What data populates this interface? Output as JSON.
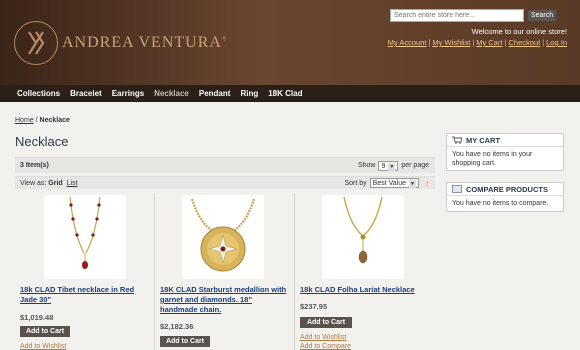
{
  "header": {
    "brand": "ANDREA VENTURA",
    "trademark": "®",
    "search_placeholder": "Search entire store here...",
    "search_button": "Search",
    "welcome": "Welcome to our online store!",
    "account_links": [
      "My Account",
      "My Wishlist",
      "My Cart",
      "Checkout",
      "Log In"
    ]
  },
  "nav": {
    "items": [
      "Collections",
      "Bracelet",
      "Earrings",
      "Necklace",
      "Pendant",
      "Ring",
      "18K Clad"
    ],
    "active": "Necklace"
  },
  "breadcrumb": {
    "home": "Home",
    "separator": "/",
    "current": "Necklace"
  },
  "page_title": "Necklace",
  "toolbar": {
    "item_count": "3 Item(s)",
    "show_label": "Show",
    "show_value": "9",
    "per_page": "per page",
    "view_as": "View as:",
    "view_grid": "Grid",
    "view_list": "List",
    "sort_by": "Sort by",
    "sort_value": "Best Value",
    "sort_direction_icon": "arrow-up-icon"
  },
  "products": [
    {
      "name": "18k CLAD Tibet necklace in Red Jade 30\"",
      "price": "$1,019.48",
      "add_to_cart": "Add to Cart",
      "link": "Add to Wishlist"
    },
    {
      "name": "18K CLAD Starburst medallion with garnet and diamonds. 18\" handmade chain.",
      "price": "$2,182.36",
      "add_to_cart": "Add to Cart"
    },
    {
      "name": "18k CLAD Folha Lariat Necklace",
      "price": "$237.95",
      "add_to_cart": "Add to Cart",
      "wishlist": "Add to Wishlist",
      "compare": "Add to Compare"
    }
  ],
  "sidebar": {
    "cart": {
      "title": "MY CART",
      "text": "You have no items in your shopping cart."
    },
    "compare": {
      "title": "COMPARE PRODUCTS",
      "text": "You have no items to compare."
    }
  },
  "colors": {
    "header_bg": "#5a3a26",
    "nav_bg": "#2a2018",
    "brand_gold": "#c9a27a",
    "link_blue": "#1a3e7a",
    "link_gold": "#f0c68a"
  }
}
